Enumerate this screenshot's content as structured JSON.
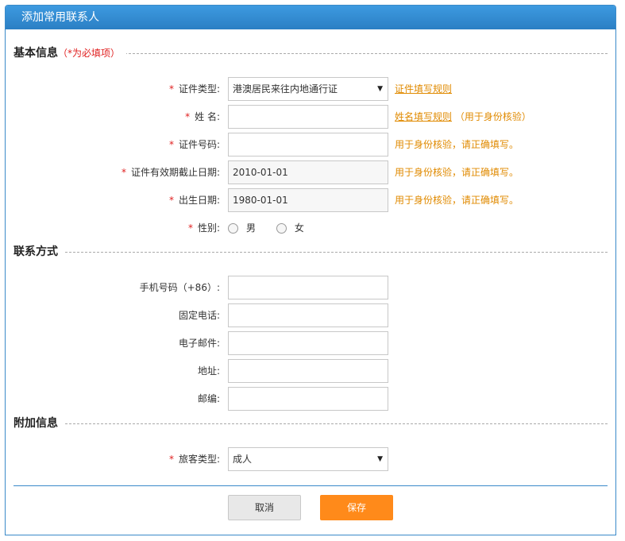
{
  "title": "添加常用联系人",
  "sections": {
    "basic": {
      "title": "基本信息",
      "hint": "（*为必填项）"
    },
    "contact": {
      "title": "联系方式"
    },
    "extra": {
      "title": "附加信息"
    }
  },
  "required_mark": "*",
  "basic": {
    "id_type": {
      "label": "证件类型:",
      "value": "港澳居民来往内地通行证",
      "link": "证件填写规则"
    },
    "name": {
      "label": "姓 名:",
      "value": "",
      "link": "姓名填写规则",
      "note": "（用于身份核验）"
    },
    "id_number": {
      "label": "证件号码:",
      "value": "",
      "note": "用于身份核验，请正确填写。"
    },
    "expiry": {
      "label": "证件有效期截止日期:",
      "value": "2010-01-01",
      "note": "用于身份核验，请正确填写。"
    },
    "birth": {
      "label": "出生日期:",
      "value": "1980-01-01",
      "note": "用于身份核验，请正确填写。"
    },
    "gender": {
      "label": "性别:",
      "options": [
        "男",
        "女"
      ]
    }
  },
  "contact": {
    "mobile": {
      "label": "手机号码（+86）:",
      "value": ""
    },
    "phone": {
      "label": "固定电话:",
      "value": ""
    },
    "email": {
      "label": "电子邮件:",
      "value": ""
    },
    "address": {
      "label": "地址:",
      "value": ""
    },
    "zip": {
      "label": "邮编:",
      "value": ""
    }
  },
  "extra": {
    "passenger_type": {
      "label": "旅客类型:",
      "value": "成人"
    }
  },
  "buttons": {
    "cancel": "取消",
    "save": "保存"
  },
  "colors": {
    "title_bar": "#2b7fc4",
    "required": "#e02020",
    "tip": "#e08a00",
    "save": "#ff8a1a"
  }
}
